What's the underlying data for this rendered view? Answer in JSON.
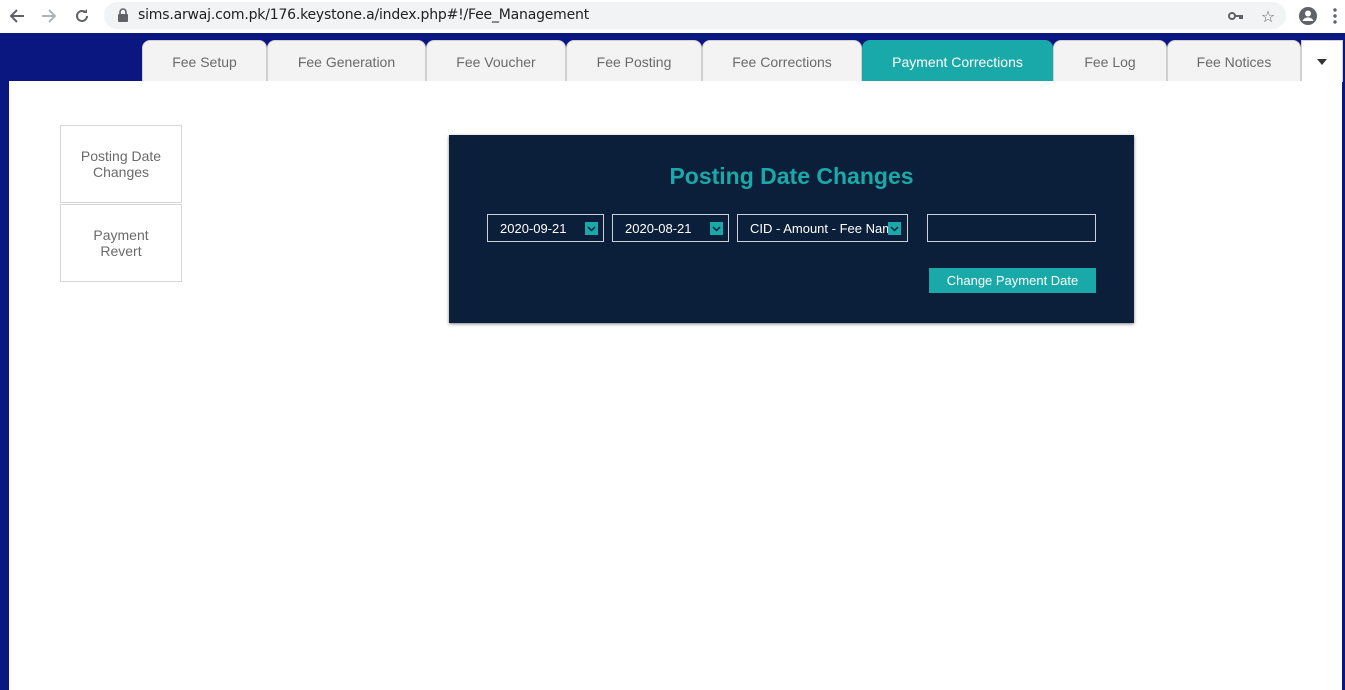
{
  "browser": {
    "url": "sims.arwaj.com.pk/176.keystone.a/index.php#!/Fee_Management",
    "icons": [
      "back-arrow-icon",
      "forward-arrow-icon",
      "reload-icon",
      "lock-icon",
      "key-icon",
      "star-icon",
      "account-icon",
      "menu-dots-icon"
    ]
  },
  "tabs": [
    {
      "label": "Fee Setup",
      "active": false
    },
    {
      "label": "Fee Generation",
      "active": false
    },
    {
      "label": "Fee Voucher",
      "active": false
    },
    {
      "label": "Fee Posting",
      "active": false
    },
    {
      "label": "Fee Corrections",
      "active": false
    },
    {
      "label": "Payment Corrections",
      "active": true
    },
    {
      "label": "Fee Log",
      "active": false
    },
    {
      "label": "Fee Notices",
      "active": false
    }
  ],
  "sidebar": {
    "items": [
      {
        "label": "Posting Date Changes"
      },
      {
        "label": "Payment Revert"
      }
    ]
  },
  "panel": {
    "title": "Posting Date Changes",
    "date_from": "2020-09-21",
    "date_to": "2020-08-21",
    "record_select": "CID - Amount - Fee Name",
    "input_value": "",
    "button_label": "Change Payment Date"
  },
  "colors": {
    "accent": "#1aa9a9",
    "frame": "#0b1780",
    "panel": "#0b1f3a"
  }
}
